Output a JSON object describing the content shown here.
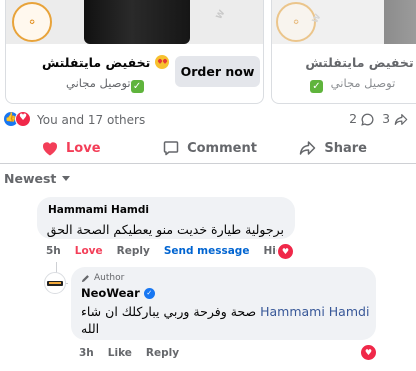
{
  "product_cards": [
    {
      "title": "تخفيض مايتفلتش",
      "shipping": "توصيل مجاني",
      "button_label": "Order now"
    },
    {
      "title": "تخفيض مايتفلتش",
      "shipping": "توصيل مجاني"
    }
  ],
  "reactions": {
    "summary": "You and 17 others",
    "comment_count": "2",
    "share_count": "3"
  },
  "actions": {
    "love": "Love",
    "comment": "Comment",
    "share": "Share"
  },
  "sort": {
    "label": "Newest"
  },
  "comments": [
    {
      "author": "Hammami Hamdi",
      "text": "برجولية طيارة خديت منو يعطيكم الصحة الحق",
      "time": "5h",
      "love": "Love",
      "reply": "Reply",
      "send_message": "Send message",
      "hide": "Hide"
    }
  ],
  "reply": {
    "badge": "Author",
    "author": "NeoWear",
    "mention": "Hammami Hamdi",
    "text": "صحة وفرحة وربي يباركلك ان شاء الله",
    "time": "3h",
    "like": "Like",
    "reply": "Reply"
  },
  "colors": {
    "love_red": "#f33e58",
    "link_blue": "#0064d1",
    "brand_blue": "#1877f2",
    "muted_gray": "#65676b"
  }
}
